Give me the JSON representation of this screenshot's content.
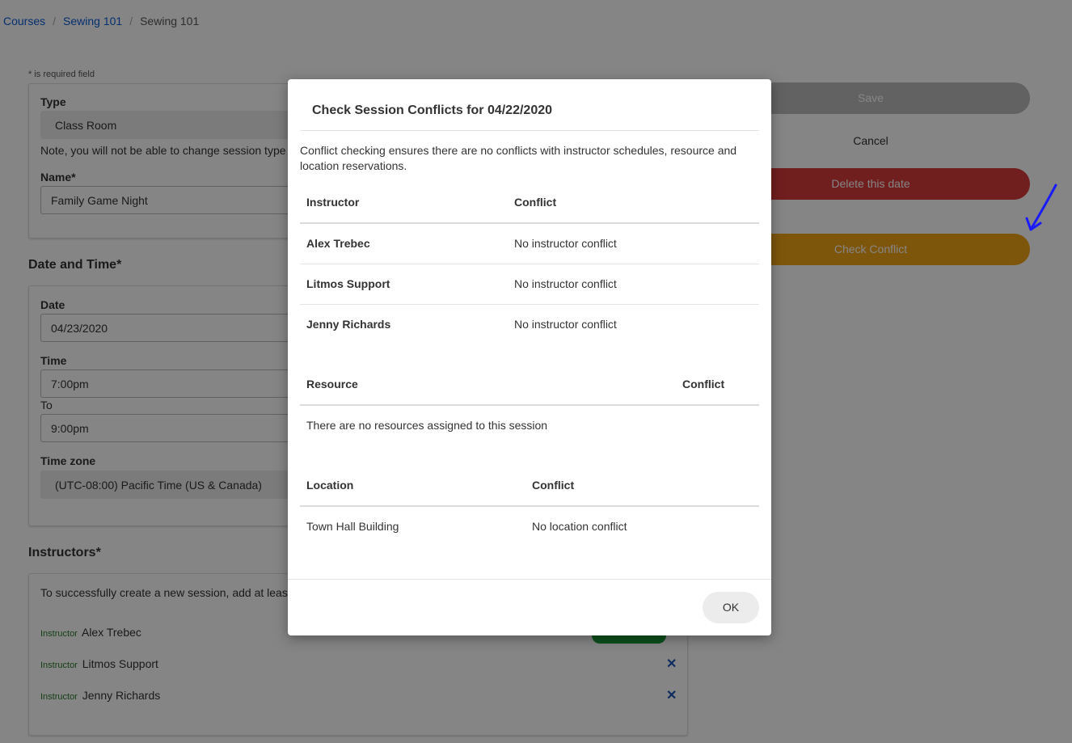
{
  "breadcrumb": {
    "items": [
      "Courses",
      "Sewing 101",
      "Sewing 101"
    ]
  },
  "form": {
    "required_note": "* is required field",
    "type_label": "Type",
    "type_value": "Class Room",
    "type_note": "Note, you will not be able to change session type",
    "name_label": "Name*",
    "name_value": "Family Game Night",
    "date_time_title": "Date and Time*",
    "date_label": "Date",
    "date_value": "04/23/2020",
    "time_label": "Time",
    "time_start": "7:00pm",
    "to_label": "To",
    "time_end": "9:00pm",
    "timezone_label": "Time zone",
    "timezone_value": "(UTC-08:00) Pacific Time (US & Canada)",
    "instructors_title": "Instructors*",
    "instructors_note": "To successfully create a new session, add at least",
    "instructor_tag": "Instructor",
    "instructors": [
      "Alex Trebec",
      "Litmos Support",
      "Jenny Richards"
    ]
  },
  "actions": {
    "save": "Save",
    "cancel": "Cancel",
    "delete": "Delete this date",
    "check": "Check Conflict"
  },
  "modal": {
    "title": "Check Session Conflicts for 04/22/2020",
    "description": "Conflict checking ensures there are no conflicts with instructor schedules, resource and location reservations.",
    "instructor_header": "Instructor",
    "conflict_header": "Conflict",
    "instructor_rows": [
      {
        "name": "Alex Trebec",
        "conflict": "No instructor conflict"
      },
      {
        "name": "Litmos Support",
        "conflict": "No instructor conflict"
      },
      {
        "name": "Jenny Richards",
        "conflict": "No instructor conflict"
      }
    ],
    "resource_header": "Resource",
    "resource_conflict_header": "Conflict",
    "resource_empty": "There are no resources assigned to this session",
    "location_header": "Location",
    "location_conflict_header": "Conflict",
    "location_rows": [
      {
        "name": "Town Hall Building",
        "conflict": "No location conflict"
      }
    ],
    "ok": "OK"
  },
  "colors": {
    "link": "#0a5bd6",
    "delete": "#d83a3a",
    "check": "#f2a516",
    "overlay": "rgba(0,0,0,0.48)"
  }
}
